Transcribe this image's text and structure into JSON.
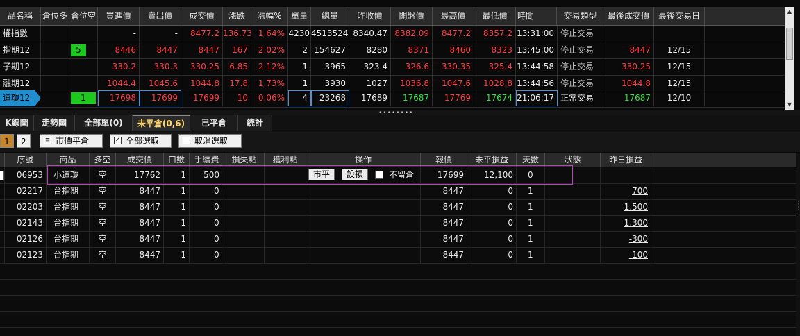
{
  "quote": {
    "headers": [
      "品名稱",
      "倉位多",
      "倉位空",
      "買進價",
      "賣出價",
      "成交價",
      "漲跌",
      "漲幅%",
      "單量",
      "總量",
      "昨收價",
      "開盤價",
      "最高價",
      "最低價",
      "時間",
      "交易類型",
      "最後成交價",
      "最後交易日"
    ],
    "rows": [
      {
        "name": "權指數",
        "long": "",
        "short": "",
        "bid": "-",
        "ask": "-",
        "last": "8477.2",
        "chg": "136.73",
        "pct": "1.64%",
        "vol": "4230",
        "total": "4513524",
        "prev": "8340.47",
        "open": "8382.09",
        "high": "8477.2",
        "low": "8357.2",
        "time": "13:31:00",
        "type": "停止交易",
        "lastprice": "",
        "lastday": ""
      },
      {
        "name": "指期12",
        "long": "",
        "short": "5",
        "bid": "8446",
        "ask": "8447",
        "last": "8447",
        "chg": "167",
        "pct": "2.02%",
        "vol": "2",
        "total": "154627",
        "prev": "8280",
        "open": "8371",
        "high": "8460",
        "low": "8323",
        "time": "13:45:00",
        "type": "停止交易",
        "lastprice": "8447",
        "lastday": "12/15"
      },
      {
        "name": "子期12",
        "long": "",
        "short": "",
        "bid": "330.2",
        "ask": "330.3",
        "last": "330.25",
        "chg": "6.85",
        "pct": "2.12%",
        "vol": "1",
        "total": "3965",
        "prev": "323.4",
        "open": "326.6",
        "high": "330.35",
        "low": "325.4",
        "time": "13:44:58",
        "type": "停止交易",
        "lastprice": "330.25",
        "lastday": "12/15"
      },
      {
        "name": "融期12",
        "long": "",
        "short": "",
        "bid": "1044.4",
        "ask": "1045.6",
        "last": "1044.8",
        "chg": "17.8",
        "pct": "1.73%",
        "vol": "1",
        "total": "3930",
        "prev": "1027",
        "open": "1036.8",
        "high": "1047.6",
        "low": "1028.8",
        "time": "13:44:56",
        "type": "停止交易",
        "lastprice": "1044.8",
        "lastday": "12/15"
      },
      {
        "name": "道瓊12",
        "long": "",
        "short": "1",
        "bid": "17698",
        "ask": "17699",
        "last": "17699",
        "chg": "10",
        "pct": "0.06%",
        "vol": "4",
        "total": "23268",
        "prev": "17689",
        "open": "17687",
        "high": "17769",
        "low": "17674",
        "time": "21:06:17",
        "type": "正常交易",
        "lastprice": "17687",
        "lastday": "12/10"
      }
    ]
  },
  "splitter": "••••••••",
  "tabs": [
    "K線圖",
    "走勢圖",
    "全部單(0)",
    "未平倉(0,6)",
    "已平倉",
    "統計"
  ],
  "toolbar": {
    "page1": "1",
    "page2": "2",
    "market_close": "市價平倉",
    "select_all": "全部選取",
    "cancel_select": "取消選取"
  },
  "orders": {
    "headers": [
      "序號",
      "商品",
      "多空",
      "成交價",
      "口數",
      "手續費",
      "損失點",
      "獲利點",
      "操作",
      "報價",
      "未平損益",
      "天數",
      "狀態",
      "昨日損益"
    ],
    "action_close": "市平",
    "action_set": "設損",
    "action_keep": "不留倉",
    "rows": [
      {
        "id": "06953",
        "product": "小道瓊",
        "side": "空",
        "price": "17762",
        "qty": "1",
        "fee": "500",
        "quote": "17699",
        "pnl": "12,100",
        "days": "0",
        "yesterday": ""
      },
      {
        "id": "02217",
        "product": "台指期",
        "side": "空",
        "price": "8447",
        "qty": "1",
        "fee": "0",
        "quote": "8447",
        "pnl": "0",
        "days": "1",
        "yesterday": "700"
      },
      {
        "id": "02203",
        "product": "台指期",
        "side": "空",
        "price": "8447",
        "qty": "1",
        "fee": "0",
        "quote": "8447",
        "pnl": "0",
        "days": "1",
        "yesterday": "1,500"
      },
      {
        "id": "02143",
        "product": "台指期",
        "side": "空",
        "price": "8447",
        "qty": "1",
        "fee": "0",
        "quote": "8447",
        "pnl": "0",
        "days": "1",
        "yesterday": "1,300"
      },
      {
        "id": "02126",
        "product": "台指期",
        "side": "空",
        "price": "8447",
        "qty": "1",
        "fee": "0",
        "quote": "8447",
        "pnl": "0",
        "days": "1",
        "yesterday": "-300"
      },
      {
        "id": "02123",
        "product": "台指期",
        "side": "空",
        "price": "8447",
        "qty": "1",
        "fee": "0",
        "quote": "8447",
        "pnl": "0",
        "days": "1",
        "yesterday": "-100"
      }
    ]
  }
}
